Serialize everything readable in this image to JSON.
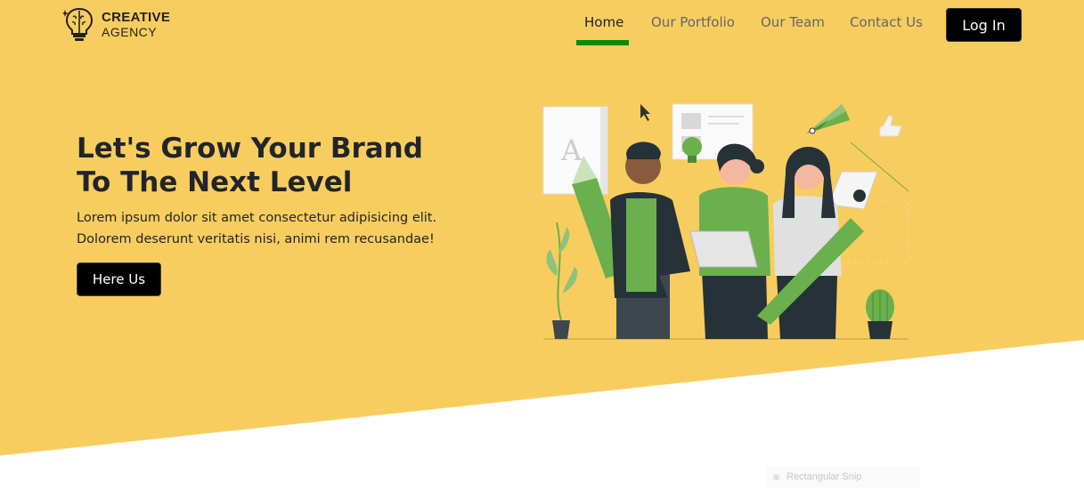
{
  "brand": {
    "line1": "CREATIVE",
    "line2": "AGENCY"
  },
  "nav": {
    "items": [
      {
        "label": "Home",
        "active": true
      },
      {
        "label": "Our Portfolio",
        "active": false
      },
      {
        "label": "Our Team",
        "active": false
      },
      {
        "label": "Contact Us",
        "active": false
      }
    ],
    "login_label": "Log In"
  },
  "hero": {
    "title": "Let's Grow Your Brand To The Next Level",
    "description": "Lorem ipsum dolor sit amet consectetur adipisicing elit. Dolorem deserunt veritatis nisi, animi rem recusandae!",
    "cta_label": "Here Us"
  },
  "snip_tooltip": {
    "label": "Rectangular Snip"
  },
  "colors": {
    "hero_bg": "#f8cd5f",
    "accent_green": "#0a8a0a",
    "button_bg": "#000000",
    "illustration_green": "#6ab04c"
  },
  "icons": [
    "brain-lightbulb-logo-icon",
    "cursor-icon",
    "thumbs-up-icon",
    "lightbulb-icon"
  ]
}
